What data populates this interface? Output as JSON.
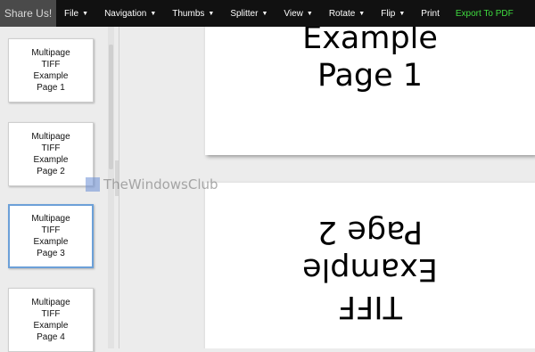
{
  "menubar": {
    "share_label": "Share Us!",
    "items": [
      {
        "label": "File",
        "dropdown": true
      },
      {
        "label": "Navigation",
        "dropdown": true
      },
      {
        "label": "Thumbs",
        "dropdown": true
      },
      {
        "label": "Splitter",
        "dropdown": true
      },
      {
        "label": "View",
        "dropdown": true
      },
      {
        "label": "Rotate",
        "dropdown": true
      },
      {
        "label": "Flip",
        "dropdown": true
      },
      {
        "label": "Print",
        "dropdown": false
      },
      {
        "label": "Export To PDF",
        "dropdown": false
      }
    ],
    "export_color": "#3fdc3f"
  },
  "thumbnails": [
    {
      "line1": "Multipage",
      "line2": "TIFF",
      "line3": "Example",
      "line4": "Page 1"
    },
    {
      "line1": "Multipage",
      "line2": "TIFF",
      "line3": "Example",
      "line4": "Page 2"
    },
    {
      "line1": "Multipage",
      "line2": "TIFF",
      "line3": "Example",
      "line4": "Page 3"
    },
    {
      "line1": "Multipage",
      "line2": "TIFF",
      "line3": "Example",
      "line4": "Page 4"
    }
  ],
  "selected_thumbnail": 3,
  "viewer": {
    "page1": {
      "line1": "Example",
      "line2": "Page 1"
    },
    "page2": {
      "line1": "TIFF",
      "line2": "Example",
      "line3": "Page 2"
    }
  },
  "watermark": {
    "text": "TheWindowsClub"
  }
}
